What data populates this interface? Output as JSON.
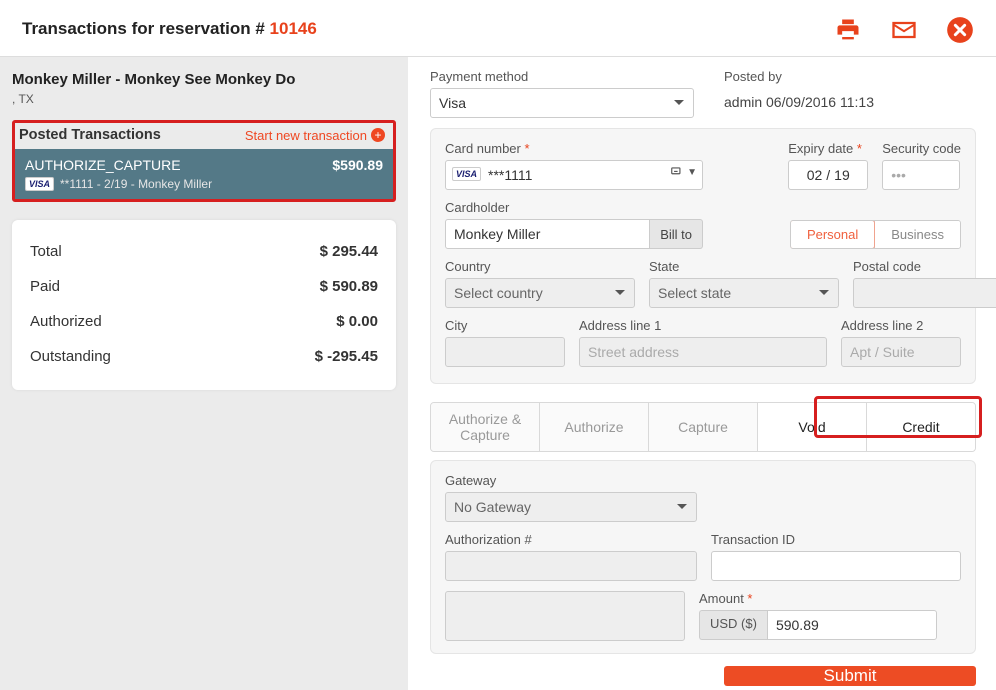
{
  "header": {
    "title_prefix": "Transactions for reservation # ",
    "reservation_number": "10146"
  },
  "guest": {
    "name": "Monkey Miller - Monkey See Monkey Do",
    "location": ", TX"
  },
  "posted": {
    "title": "Posted Transactions",
    "start_new": "Start new transaction",
    "tx_type": "AUTHORIZE_CAPTURE",
    "tx_amount": "$590.89",
    "tx_detail": "**1111 - 2/19 - Monkey Miller"
  },
  "summary": {
    "total_label": "Total",
    "total_value": "$ 295.44",
    "paid_label": "Paid",
    "paid_value": "$ 590.89",
    "auth_label": "Authorized",
    "auth_value": "$ 0.00",
    "out_label": "Outstanding",
    "out_value": "$ -295.45"
  },
  "form": {
    "payment_method_label": "Payment method",
    "payment_method_value": "Visa",
    "posted_by_label": "Posted by",
    "posted_by_value": "admin 06/09/2016 11:13",
    "card_number_label": "Card number",
    "card_number_value": "***1111",
    "expiry_label": "Expiry date",
    "expiry_mm": "02",
    "expiry_yy": "19",
    "sec_label": "Security code",
    "sec_placeholder": "•••",
    "cardholder_label": "Cardholder",
    "cardholder_value": "Monkey Miller",
    "billto_label": "Bill to",
    "seg_personal": "Personal",
    "seg_business": "Business",
    "country_label": "Country",
    "country_value": "Select country",
    "state_label": "State",
    "state_value": "Select state",
    "postal_label": "Postal code",
    "city_label": "City",
    "addr1_label": "Address line 1",
    "addr1_placeholder": "Street address",
    "addr2_label": "Address line 2",
    "addr2_placeholder": "Apt / Suite"
  },
  "tabs": {
    "t1": "Authorize & Capture",
    "t2": "Authorize",
    "t3": "Capture",
    "t4": "Void",
    "t5": "Credit"
  },
  "gateway": {
    "gateway_label": "Gateway",
    "gateway_value": "No Gateway",
    "authnum_label": "Authorization #",
    "txid_label": "Transaction ID",
    "amount_label": "Amount",
    "currency": "USD ($)",
    "amount_value": "590.89"
  },
  "submit_label": "Submit"
}
